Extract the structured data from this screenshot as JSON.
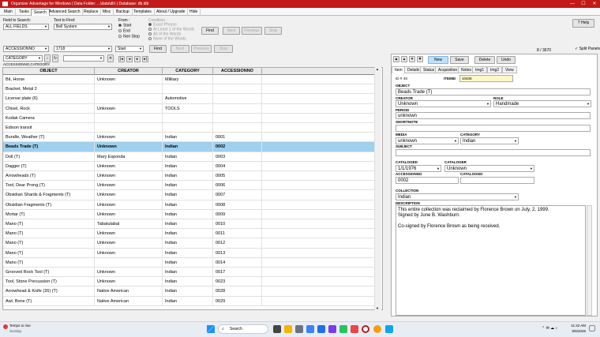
{
  "title_bar": {
    "title": "Organizer Advantage for Windows | Data Folder: ...\\data\\db\\ | Database: db.ldb",
    "minimize": "—",
    "maximize": "☐",
    "close": "✕"
  },
  "menu": [
    "Main",
    "Tasks",
    "Search",
    "Advanced Search",
    "Replace",
    "Misc",
    "Backup",
    "Templates",
    "About / Upgrade",
    "Hide"
  ],
  "menu_active_index": 2,
  "search": {
    "field_label": "Field to Search:",
    "field_value": "ALL FIELDS",
    "text_label": "Text to Find:",
    "text_value": "Bell System",
    "from_label": "From :",
    "from_options": [
      "Start",
      "End",
      "Non Stop"
    ],
    "condition_label": "Condition :",
    "condition_options": [
      "Exact Phrase",
      "At Least 1 of the Words",
      "All of the Words",
      "None of the Words"
    ],
    "find_btn": "Find",
    "next_btn": "Next",
    "previous_btn": "Previous",
    "stop_btn": "Stop",
    "help_btn": "Help",
    "record_count": "8 / 3670",
    "split_panels": "Split Panels"
  },
  "search2": {
    "field_value": "ACCESSIONNO",
    "text_value": "1718",
    "from_value": "Start",
    "find_btn": "Find",
    "next_btn": "Next",
    "previous_btn": "Previous",
    "stop_btn": "Stop"
  },
  "sort": {
    "field_value": "CATEGORY",
    "caption": "ACCESSIONNO,CATEGORY",
    "filter_value": ""
  },
  "grid": {
    "columns": [
      "OBJECT",
      "CREATOR",
      "CATEGORY",
      "ACCESSIONNO"
    ],
    "rows": [
      [
        "Bit, Horse",
        "Unknown",
        "Military",
        ""
      ],
      [
        "Bracket, Metal 2",
        "",
        "",
        ""
      ],
      [
        "License plate (6)",
        "",
        "Automotive",
        ""
      ],
      [
        "Chisel, Rock",
        "Unknown",
        "TOOLS",
        ""
      ],
      [
        "Kodak Camera",
        "",
        "",
        ""
      ],
      [
        "Edison transit",
        "",
        "",
        ""
      ],
      [
        "Bundle, Weather (T)",
        "Unknown",
        "Indian",
        "0001"
      ],
      [
        "Beads Trade (T)",
        "Unknown",
        "Indian",
        "0002"
      ],
      [
        "Doll (T)",
        "Mary Esponda",
        "Indian",
        "0003"
      ],
      [
        "Dagger (T)",
        "Unknown",
        "Indian",
        "0004"
      ],
      [
        "Arrowheads (T)",
        "Unknown",
        "Indian",
        "0005"
      ],
      [
        "Tool, Dear Prong (T)",
        "Unknown",
        "Indian",
        "0006"
      ],
      [
        "Obsidian Shards & Fragments (T)",
        "Unknown",
        "Indian",
        "0007"
      ],
      [
        "Obsidian Fragments (T)",
        "Unknown",
        "Indian",
        "0008"
      ],
      [
        "Mortar (T)",
        "Unknown",
        "Indian",
        "0009"
      ],
      [
        "Mano (T)",
        "Tabatulabal",
        "Indian",
        "0010"
      ],
      [
        "Mano (T)",
        "Unknown",
        "Indian",
        "0011"
      ],
      [
        "Mano (T)",
        "Unknown",
        "Indian",
        "0012"
      ],
      [
        "Mano (T)",
        "Unknown",
        "Indian",
        "0013"
      ],
      [
        "Mano (T)",
        "",
        "Indian",
        "0014"
      ],
      [
        "Grooved Rock Tool (T)",
        "Unknown",
        "Indian",
        "0017"
      ],
      [
        "Tool, Stone Precussion (T)",
        "Unknown",
        "Indian",
        "0023"
      ],
      [
        "Arrowhead & Knife (26) (T)",
        "Native American",
        "Indian",
        "0028"
      ],
      [
        "Awl, Bone (T)",
        "Native American",
        "Indian",
        "0029"
      ]
    ],
    "selected_index": 7
  },
  "record_toolbar": {
    "new_btn": "New",
    "save_btn": "Save",
    "delete_btn": "Delete",
    "undo_btn": "Undo"
  },
  "tabs": [
    "Item",
    "Details",
    "Status",
    "Acquisition",
    "Notes",
    "Img1",
    "Img2",
    "View"
  ],
  "active_tab_index": 0,
  "record": {
    "id_label": "ID #",
    "id_value": "40",
    "itemid_label": "ITEMID",
    "itemid_value": "10408",
    "object_label": "OBJECT",
    "object_value": "Beads Trade (T)",
    "creator_label": "CREATOR",
    "creator_value": "Unknown",
    "role_label": "ROLE",
    "role_value": "Handmade",
    "period_label": "PERIOD",
    "period_value": "unknown",
    "shortnote_label": "SHORTNOTE",
    "shortnote_value": "",
    "media_label": "MEDIA",
    "media_value": "unknown",
    "category_label": "CATEGORY",
    "category_value": "Indian",
    "subject_label": "SUBJECT",
    "subject_value": "",
    "cataloged_label": "CATALOGED",
    "cataloged_value": "1/1/1976",
    "cataloger_label": "CATALOGER",
    "cataloger_value": "Unknown",
    "accessionno_label": "ACCESSIONNO",
    "accessionno_value": "0002",
    "catalogno_label": "CATALOGNO",
    "catalogno_value": "",
    "collection_label": "COLLECTION",
    "collection_value": "Indian",
    "description_label": "DESCRIPTION",
    "description_lines": [
      "This entire collection was reclaimed by Florence Brown on July, 2, 1999.",
      "Signed by June B. Washburn.",
      "",
      "Co-signed by Florence Brown as being received."
    ]
  },
  "taskbar": {
    "weather": "Temps to rise",
    "weather_sub": "Sunday",
    "search_placeholder": "Search",
    "time": "11:42 AM",
    "date": "5/6/2026"
  }
}
